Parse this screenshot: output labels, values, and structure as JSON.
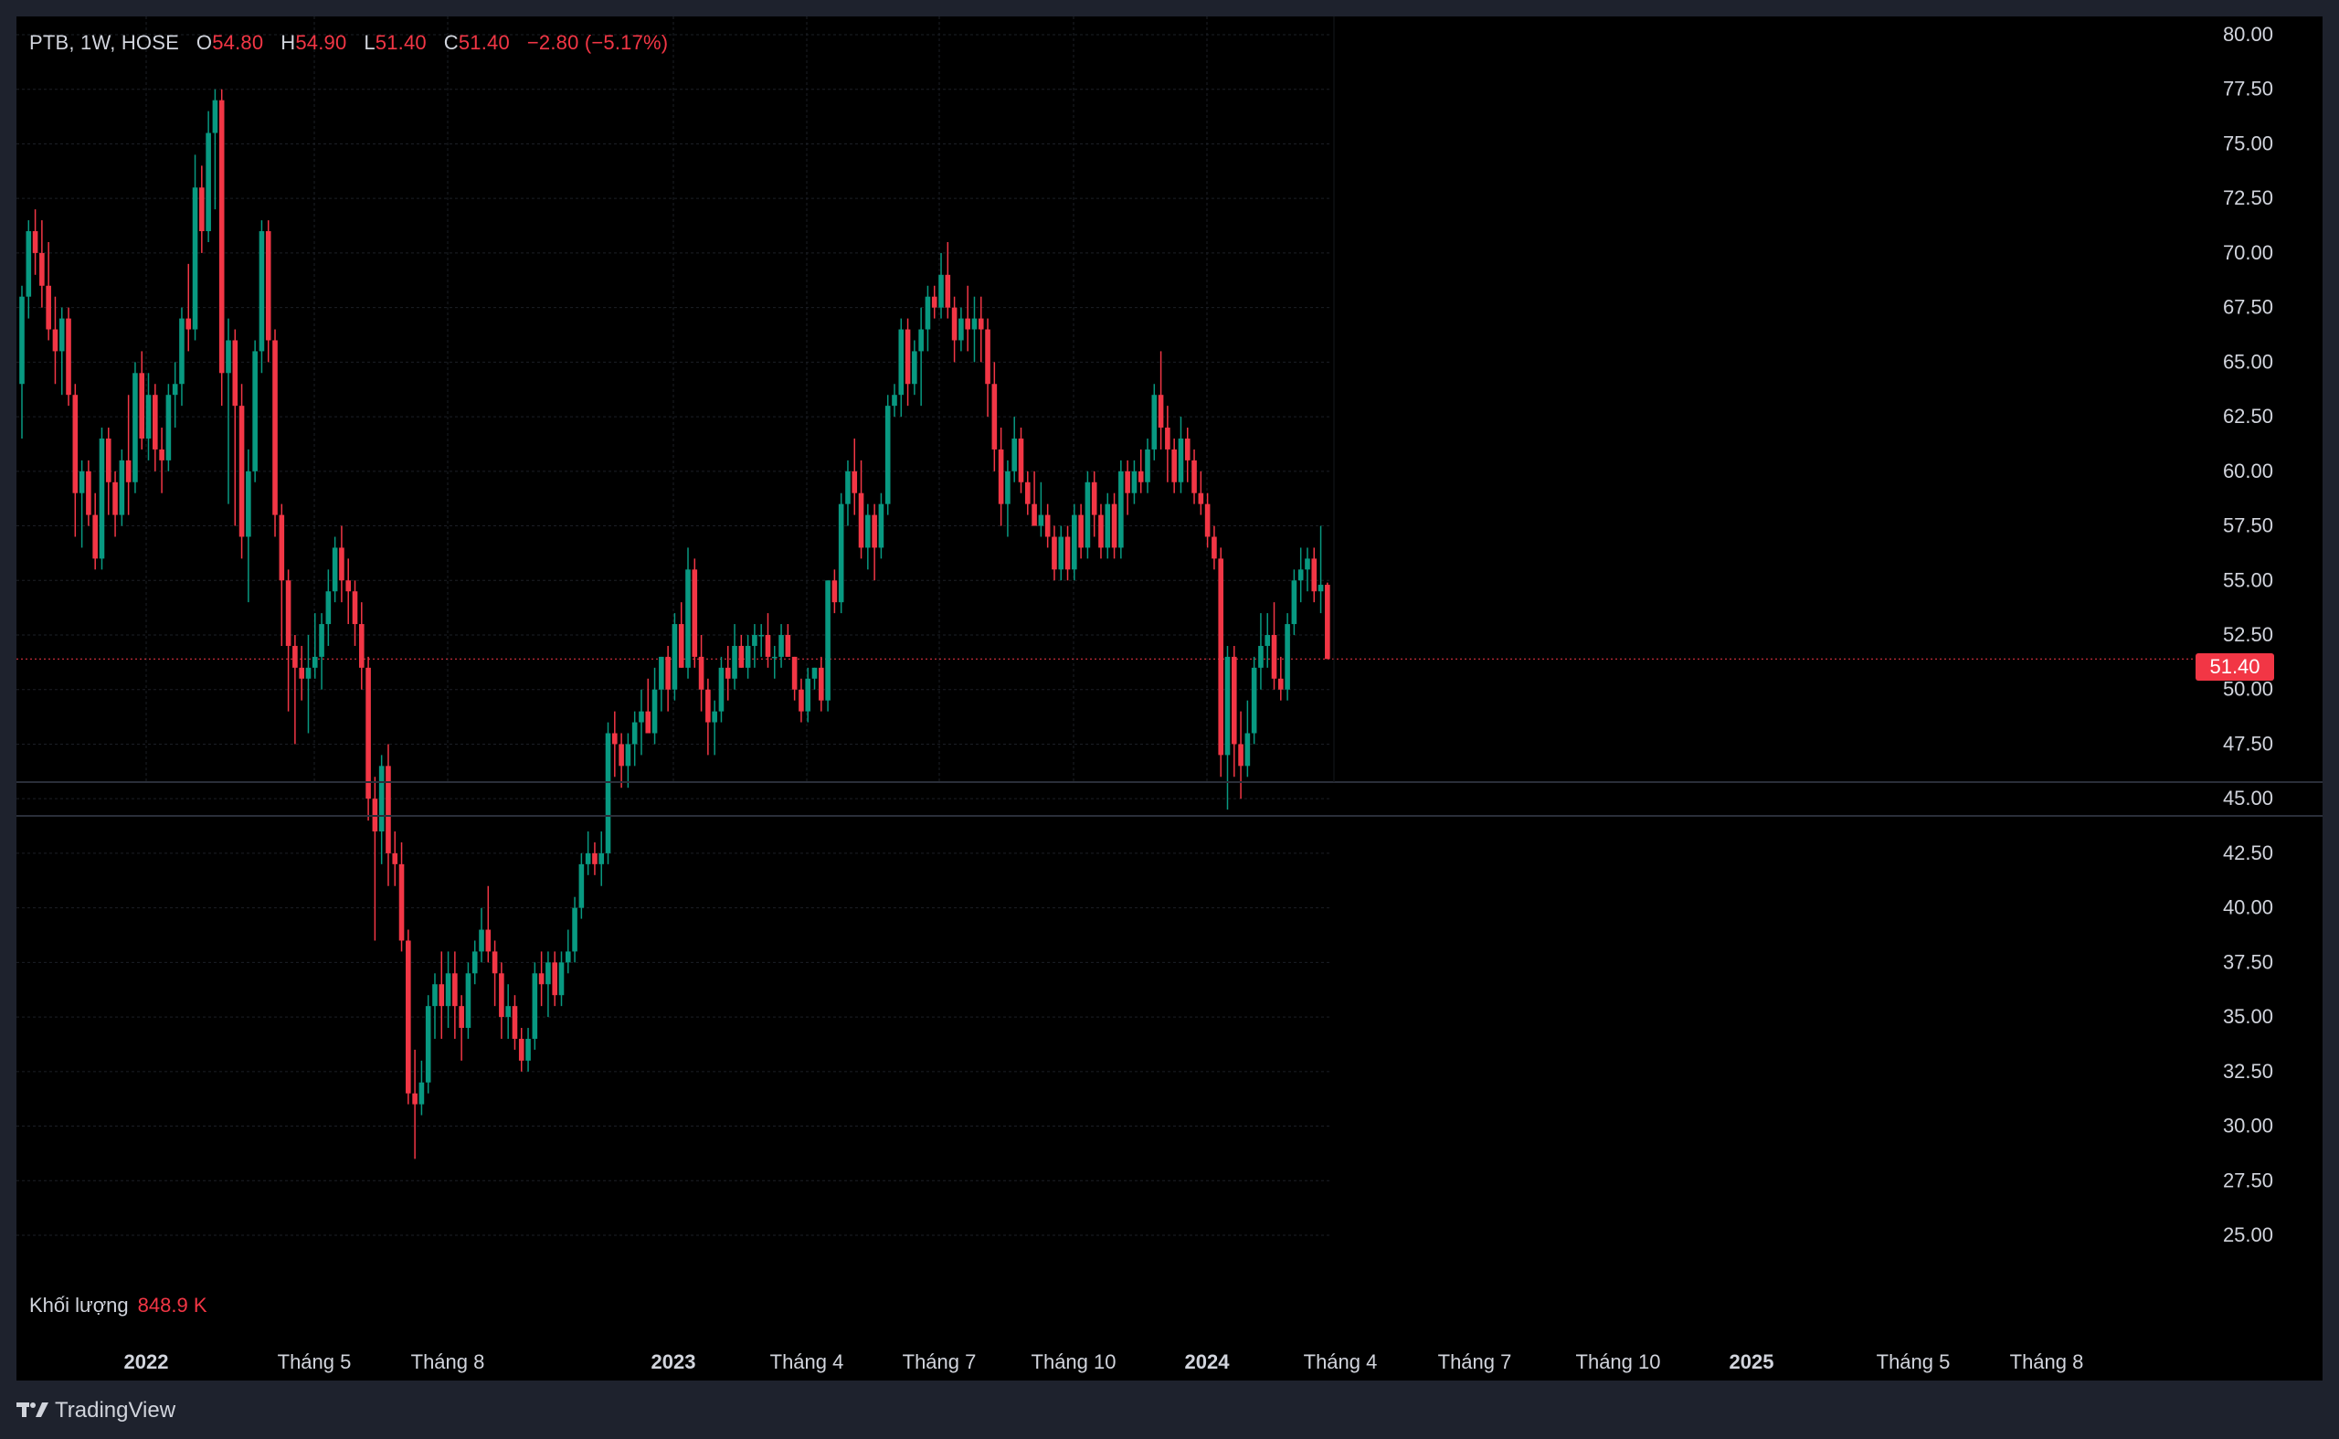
{
  "legend": {
    "symbol": "PTB, 1W, HOSE",
    "open_label": "O",
    "open": "54.80",
    "high_label": "H",
    "high": "54.90",
    "low_label": "L",
    "low": "51.40",
    "close_label": "C",
    "close": "51.40",
    "change": "−2.80 (−5.17%)"
  },
  "volume": {
    "label": "Khối lượng",
    "value": "848.9 K"
  },
  "last_price_tag": "51.40",
  "branding": {
    "text": "TradingView",
    "icon": "tradingview-logo-icon"
  },
  "colors": {
    "up": "#089981",
    "down": "#f23645",
    "background": "#000000",
    "frame": "#1e222d",
    "grid": "#1c1f26",
    "text": "#d1d4dc"
  },
  "chart_data": {
    "type": "candlestick",
    "symbol": "PTB",
    "interval": "1W",
    "exchange": "HOSE",
    "ylim": [
      25,
      80
    ],
    "y_ticks": [
      "25.00",
      "27.50",
      "30.00",
      "32.50",
      "35.00",
      "37.50",
      "40.00",
      "42.50",
      "45.00",
      "47.50",
      "50.00",
      "52.50",
      "55.00",
      "57.50",
      "60.00",
      "62.50",
      "65.00",
      "67.50",
      "70.00",
      "72.50",
      "75.00",
      "77.50",
      "80.00"
    ],
    "x_ticks": [
      {
        "label": "2022",
        "year": true
      },
      {
        "label": "Tháng 5",
        "year": false
      },
      {
        "label": "Tháng 8",
        "year": false
      },
      {
        "label": "2023",
        "year": true
      },
      {
        "label": "Tháng 4",
        "year": false
      },
      {
        "label": "Tháng 7",
        "year": false
      },
      {
        "label": "Tháng 10",
        "year": false
      },
      {
        "label": "2024",
        "year": true
      },
      {
        "label": "Tháng 4",
        "year": false
      },
      {
        "label": "Tháng 7",
        "year": false
      },
      {
        "label": "Tháng 10",
        "year": false
      },
      {
        "label": "2025",
        "year": true
      },
      {
        "label": "Tháng 5",
        "year": false
      },
      {
        "label": "Tháng 8",
        "year": false
      }
    ],
    "last_close": 51.4,
    "candles": [
      [
        64.0,
        68.5,
        61.5,
        68.0
      ],
      [
        68.0,
        71.5,
        67.0,
        71.0
      ],
      [
        71.0,
        72.0,
        69.0,
        70.0
      ],
      [
        70.0,
        71.5,
        67.5,
        68.5
      ],
      [
        68.5,
        70.5,
        66.0,
        66.5
      ],
      [
        66.5,
        68.0,
        64.0,
        65.5
      ],
      [
        65.5,
        67.5,
        63.5,
        67.0
      ],
      [
        67.0,
        67.5,
        63.0,
        63.5
      ],
      [
        63.5,
        64.0,
        57.0,
        59.0
      ],
      [
        59.0,
        60.5,
        56.5,
        60.0
      ],
      [
        60.0,
        60.5,
        57.5,
        58.0
      ],
      [
        58.0,
        59.0,
        55.5,
        56.0
      ],
      [
        56.0,
        62.0,
        55.5,
        61.5
      ],
      [
        61.5,
        62.0,
        58.0,
        59.5
      ],
      [
        59.5,
        60.0,
        57.0,
        58.0
      ],
      [
        58.0,
        61.0,
        57.5,
        60.5
      ],
      [
        60.5,
        63.5,
        58.0,
        59.5
      ],
      [
        59.5,
        65.0,
        59.0,
        64.5
      ],
      [
        64.5,
        65.5,
        61.0,
        61.5
      ],
      [
        61.5,
        64.5,
        60.5,
        63.5
      ],
      [
        63.5,
        64.0,
        60.0,
        61.0
      ],
      [
        61.0,
        62.0,
        59.0,
        60.5
      ],
      [
        60.5,
        64.0,
        60.0,
        63.5
      ],
      [
        63.5,
        65.0,
        62.0,
        64.0
      ],
      [
        64.0,
        67.5,
        63.0,
        67.0
      ],
      [
        67.0,
        69.5,
        65.5,
        66.5
      ],
      [
        66.5,
        74.5,
        66.0,
        73.0
      ],
      [
        73.0,
        74.0,
        70.0,
        71.0
      ],
      [
        71.0,
        76.5,
        70.5,
        75.5
      ],
      [
        75.5,
        77.5,
        72.0,
        77.0
      ],
      [
        77.0,
        77.5,
        63.0,
        64.5
      ],
      [
        64.5,
        67.0,
        58.5,
        66.0
      ],
      [
        66.0,
        66.5,
        57.5,
        63.0
      ],
      [
        63.0,
        64.0,
        56.0,
        57.0
      ],
      [
        57.0,
        61.0,
        54.0,
        60.0
      ],
      [
        60.0,
        66.0,
        59.5,
        65.5
      ],
      [
        65.5,
        71.5,
        64.5,
        71.0
      ],
      [
        71.0,
        71.5,
        65.0,
        66.0
      ],
      [
        66.0,
        66.5,
        57.0,
        58.0
      ],
      [
        58.0,
        58.5,
        52.0,
        55.0
      ],
      [
        55.0,
        55.5,
        49.0,
        52.0
      ],
      [
        52.0,
        52.5,
        47.5,
        51.0
      ],
      [
        51.0,
        52.0,
        49.5,
        50.5
      ],
      [
        50.5,
        52.5,
        48.0,
        51.0
      ],
      [
        51.0,
        53.5,
        50.5,
        51.5
      ],
      [
        51.5,
        53.5,
        50.0,
        53.0
      ],
      [
        53.0,
        55.5,
        52.0,
        54.5
      ],
      [
        54.5,
        57.0,
        54.0,
        56.5
      ],
      [
        56.5,
        57.5,
        54.0,
        55.0
      ],
      [
        55.0,
        56.0,
        53.0,
        54.5
      ],
      [
        54.5,
        55.0,
        52.0,
        53.0
      ],
      [
        53.0,
        54.0,
        50.0,
        51.0
      ],
      [
        51.0,
        51.5,
        44.0,
        45.0
      ],
      [
        45.0,
        46.0,
        38.5,
        43.5
      ],
      [
        43.5,
        47.0,
        42.0,
        46.5
      ],
      [
        46.5,
        47.5,
        41.0,
        42.5
      ],
      [
        42.5,
        43.5,
        41.0,
        42.0
      ],
      [
        42.0,
        43.0,
        38.0,
        38.5
      ],
      [
        38.5,
        39.0,
        31.0,
        31.5
      ],
      [
        31.5,
        33.5,
        28.5,
        31.0
      ],
      [
        31.0,
        33.0,
        30.5,
        32.0
      ],
      [
        32.0,
        36.0,
        31.5,
        35.5
      ],
      [
        35.5,
        37.0,
        34.0,
        36.5
      ],
      [
        36.5,
        38.0,
        34.0,
        35.5
      ],
      [
        35.5,
        38.0,
        34.5,
        37.0
      ],
      [
        37.0,
        38.0,
        34.0,
        35.5
      ],
      [
        35.5,
        36.0,
        33.0,
        34.5
      ],
      [
        34.5,
        37.5,
        34.0,
        37.0
      ],
      [
        37.0,
        38.5,
        36.5,
        38.0
      ],
      [
        38.0,
        40.0,
        37.5,
        39.0
      ],
      [
        39.0,
        41.0,
        37.5,
        38.0
      ],
      [
        38.0,
        38.5,
        35.5,
        37.0
      ],
      [
        37.0,
        37.5,
        34.0,
        35.0
      ],
      [
        35.0,
        36.5,
        34.0,
        35.5
      ],
      [
        35.5,
        36.0,
        33.5,
        34.0
      ],
      [
        34.0,
        34.5,
        32.5,
        33.0
      ],
      [
        33.0,
        34.5,
        32.5,
        34.0
      ],
      [
        34.0,
        37.5,
        33.5,
        37.0
      ],
      [
        37.0,
        38.0,
        35.5,
        36.5
      ],
      [
        36.5,
        38.0,
        35.0,
        37.5
      ],
      [
        37.5,
        38.0,
        35.5,
        36.0
      ],
      [
        36.0,
        38.0,
        35.5,
        37.5
      ],
      [
        37.5,
        39.0,
        37.0,
        38.0
      ],
      [
        38.0,
        40.5,
        37.5,
        40.0
      ],
      [
        40.0,
        42.5,
        39.5,
        42.0
      ],
      [
        42.0,
        43.5,
        41.5,
        42.5
      ],
      [
        42.5,
        43.0,
        41.5,
        42.0
      ],
      [
        42.0,
        43.5,
        41.0,
        42.5
      ],
      [
        42.5,
        48.5,
        42.0,
        48.0
      ],
      [
        48.0,
        49.0,
        46.0,
        47.5
      ],
      [
        47.5,
        48.0,
        45.5,
        46.5
      ],
      [
        46.5,
        48.0,
        45.5,
        47.5
      ],
      [
        47.5,
        49.0,
        46.5,
        48.5
      ],
      [
        48.5,
        50.0,
        47.0,
        49.0
      ],
      [
        49.0,
        50.5,
        48.0,
        48.0
      ],
      [
        48.0,
        51.0,
        47.5,
        50.0
      ],
      [
        50.0,
        51.5,
        49.0,
        51.5
      ],
      [
        51.5,
        52.0,
        49.0,
        50.0
      ],
      [
        50.0,
        53.5,
        49.5,
        53.0
      ],
      [
        53.0,
        54.0,
        51.0,
        51.0
      ],
      [
        51.0,
        56.5,
        50.5,
        55.5
      ],
      [
        55.5,
        56.0,
        51.0,
        51.5
      ],
      [
        51.5,
        52.5,
        49.0,
        50.0
      ],
      [
        50.0,
        50.5,
        47.0,
        48.5
      ],
      [
        48.5,
        49.5,
        47.0,
        49.0
      ],
      [
        49.0,
        51.5,
        48.5,
        51.0
      ],
      [
        51.0,
        52.0,
        49.5,
        50.5
      ],
      [
        50.5,
        53.0,
        50.0,
        52.0
      ],
      [
        52.0,
        52.5,
        51.0,
        51.0
      ],
      [
        51.0,
        52.5,
        50.5,
        52.0
      ],
      [
        52.0,
        53.0,
        51.0,
        52.5
      ],
      [
        52.5,
        53.0,
        51.5,
        52.5
      ],
      [
        52.5,
        53.5,
        51.0,
        51.5
      ],
      [
        51.5,
        52.0,
        50.5,
        51.5
      ],
      [
        51.5,
        53.0,
        51.0,
        52.5
      ],
      [
        52.5,
        53.0,
        51.5,
        51.5
      ],
      [
        51.5,
        51.5,
        49.5,
        50.0
      ],
      [
        50.0,
        50.5,
        48.5,
        49.0
      ],
      [
        49.0,
        51.0,
        48.5,
        50.5
      ],
      [
        50.5,
        51.0,
        50.0,
        51.0
      ],
      [
        51.0,
        51.5,
        49.0,
        49.5
      ],
      [
        49.5,
        55.0,
        49.0,
        55.0
      ],
      [
        55.0,
        55.5,
        53.5,
        54.0
      ],
      [
        54.0,
        59.0,
        53.5,
        58.5
      ],
      [
        58.5,
        60.5,
        57.5,
        60.0
      ],
      [
        60.0,
        61.5,
        58.0,
        59.0
      ],
      [
        59.0,
        60.5,
        56.0,
        56.5
      ],
      [
        56.5,
        58.5,
        55.5,
        58.0
      ],
      [
        58.0,
        58.5,
        55.0,
        56.5
      ],
      [
        56.5,
        59.0,
        56.0,
        58.5
      ],
      [
        58.5,
        63.5,
        58.0,
        63.0
      ],
      [
        63.0,
        64.0,
        62.5,
        63.5
      ],
      [
        63.5,
        67.0,
        62.5,
        66.5
      ],
      [
        66.5,
        67.0,
        63.0,
        64.0
      ],
      [
        64.0,
        66.0,
        63.5,
        65.5
      ],
      [
        65.5,
        67.5,
        63.0,
        66.5
      ],
      [
        66.5,
        68.5,
        65.5,
        68.0
      ],
      [
        68.0,
        68.5,
        67.0,
        67.5
      ],
      [
        67.5,
        70.0,
        67.0,
        69.0
      ],
      [
        69.0,
        70.5,
        67.0,
        67.5
      ],
      [
        67.5,
        68.0,
        65.0,
        66.0
      ],
      [
        66.0,
        67.5,
        65.5,
        67.0
      ],
      [
        67.0,
        68.5,
        65.5,
        66.5
      ],
      [
        66.5,
        68.0,
        65.0,
        67.0
      ],
      [
        67.0,
        68.0,
        65.0,
        66.5
      ],
      [
        66.5,
        67.0,
        62.5,
        64.0
      ],
      [
        64.0,
        65.0,
        60.0,
        61.0
      ],
      [
        61.0,
        62.0,
        57.5,
        58.5
      ],
      [
        58.5,
        60.5,
        57.0,
        60.0
      ],
      [
        60.0,
        62.5,
        59.5,
        61.5
      ],
      [
        61.5,
        62.0,
        59.0,
        59.5
      ],
      [
        59.5,
        60.0,
        58.0,
        58.5
      ],
      [
        58.5,
        60.0,
        57.5,
        57.5
      ],
      [
        57.5,
        59.5,
        57.0,
        58.0
      ],
      [
        58.0,
        58.5,
        56.5,
        57.0
      ],
      [
        57.0,
        57.5,
        55.0,
        55.5
      ],
      [
        55.5,
        57.5,
        55.0,
        57.0
      ],
      [
        57.0,
        57.5,
        55.0,
        55.5
      ],
      [
        55.5,
        58.5,
        55.0,
        58.0
      ],
      [
        58.0,
        58.5,
        56.0,
        56.5
      ],
      [
        56.5,
        60.0,
        56.0,
        59.5
      ],
      [
        59.5,
        60.0,
        57.0,
        58.0
      ],
      [
        58.0,
        58.5,
        56.0,
        56.5
      ],
      [
        56.5,
        59.0,
        56.0,
        58.5
      ],
      [
        58.5,
        59.0,
        56.0,
        56.5
      ],
      [
        56.5,
        60.5,
        56.0,
        60.0
      ],
      [
        60.0,
        60.5,
        58.0,
        59.0
      ],
      [
        59.0,
        60.5,
        58.5,
        60.0
      ],
      [
        60.0,
        61.0,
        59.0,
        59.5
      ],
      [
        59.5,
        61.5,
        59.0,
        61.0
      ],
      [
        61.0,
        64.0,
        60.5,
        63.5
      ],
      [
        63.5,
        65.5,
        61.0,
        62.0
      ],
      [
        62.0,
        63.0,
        59.5,
        61.0
      ],
      [
        61.0,
        61.5,
        59.0,
        59.5
      ],
      [
        59.5,
        62.5,
        59.0,
        61.5
      ],
      [
        61.5,
        62.0,
        59.5,
        60.5
      ],
      [
        60.5,
        61.0,
        58.5,
        59.0
      ],
      [
        59.0,
        60.0,
        58.0,
        58.5
      ],
      [
        58.5,
        59.0,
        56.5,
        57.0
      ],
      [
        57.0,
        57.5,
        55.5,
        56.0
      ],
      [
        56.0,
        56.5,
        46.0,
        47.0
      ],
      [
        47.0,
        52.0,
        44.5,
        51.5
      ],
      [
        51.5,
        52.0,
        46.0,
        47.5
      ],
      [
        47.5,
        49.0,
        45.0,
        46.5
      ],
      [
        46.5,
        49.5,
        46.0,
        48.0
      ],
      [
        48.0,
        51.5,
        47.5,
        51.0
      ],
      [
        51.0,
        53.5,
        50.0,
        52.0
      ],
      [
        52.0,
        53.5,
        51.0,
        52.5
      ],
      [
        52.5,
        54.0,
        50.0,
        50.5
      ],
      [
        50.5,
        51.5,
        49.5,
        50.0
      ],
      [
        50.0,
        53.5,
        49.5,
        53.0
      ],
      [
        53.0,
        55.5,
        52.5,
        55.0
      ],
      [
        55.0,
        56.5,
        54.0,
        55.5
      ],
      [
        55.5,
        56.5,
        54.5,
        56.0
      ],
      [
        56.0,
        56.5,
        54.0,
        54.5
      ],
      [
        54.5,
        57.5,
        53.5,
        54.8
      ],
      [
        54.8,
        54.9,
        51.4,
        51.4
      ]
    ]
  }
}
